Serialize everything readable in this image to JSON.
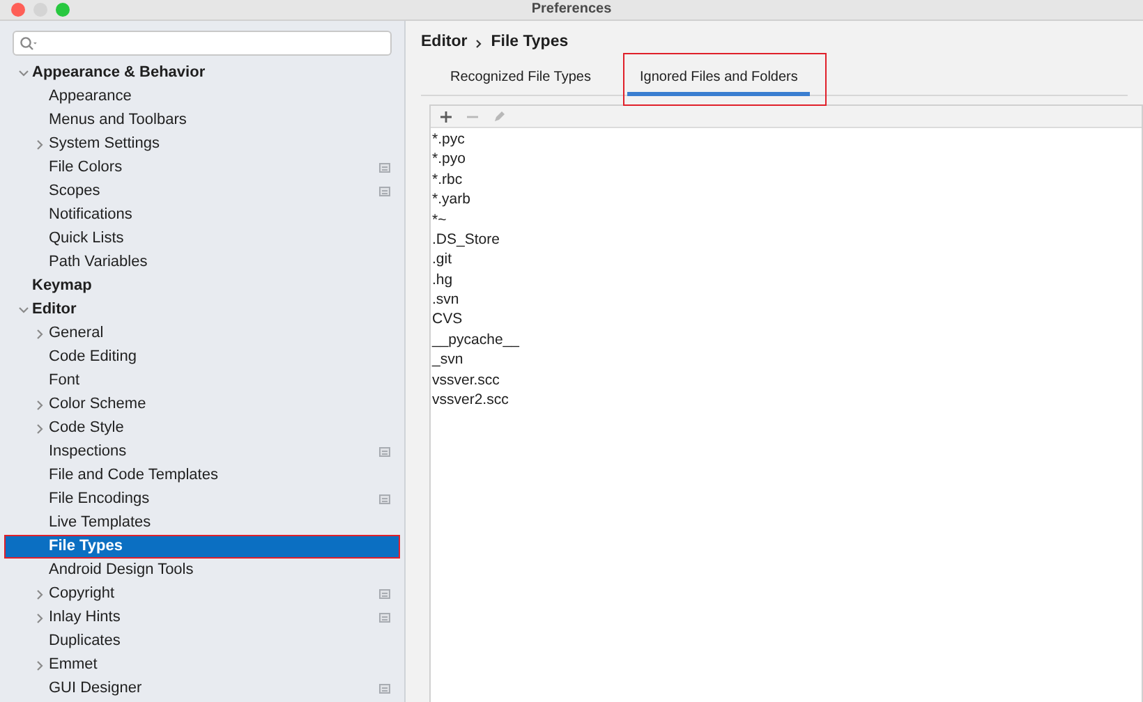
{
  "window": {
    "title": "Preferences",
    "buttons": [
      {
        "kind": "close",
        "disabled": false
      },
      {
        "kind": "minimize",
        "disabled": true
      },
      {
        "kind": "zoom",
        "disabled": false
      }
    ]
  },
  "sidebar": {
    "items": [
      {
        "label": "Appearance & Behavior",
        "expanded": true,
        "selected": false,
        "annotated": false,
        "scope_icon": false,
        "children": [
          {
            "label": "Appearance",
            "selected": false,
            "annotated": false,
            "scope_icon": false
          },
          {
            "label": "Menus and Toolbars",
            "selected": false,
            "annotated": false,
            "scope_icon": false
          },
          {
            "label": "System Settings",
            "expanded": false,
            "selected": false,
            "annotated": false,
            "scope_icon": false
          },
          {
            "label": "File Colors",
            "selected": false,
            "annotated": false,
            "scope_icon": true
          },
          {
            "label": "Scopes",
            "selected": false,
            "annotated": false,
            "scope_icon": true
          },
          {
            "label": "Notifications",
            "selected": false,
            "annotated": false,
            "scope_icon": false
          },
          {
            "label": "Quick Lists",
            "selected": false,
            "annotated": false,
            "scope_icon": false
          },
          {
            "label": "Path Variables",
            "selected": false,
            "annotated": false,
            "scope_icon": false
          }
        ]
      },
      {
        "label": "Keymap",
        "selected": false,
        "annotated": false,
        "scope_icon": false
      },
      {
        "label": "Editor",
        "expanded": true,
        "selected": false,
        "annotated": false,
        "scope_icon": false,
        "children": [
          {
            "label": "General",
            "expanded": false,
            "selected": false,
            "annotated": false,
            "scope_icon": false
          },
          {
            "label": "Code Editing",
            "selected": false,
            "annotated": false,
            "scope_icon": false
          },
          {
            "label": "Font",
            "selected": false,
            "annotated": false,
            "scope_icon": false
          },
          {
            "label": "Color Scheme",
            "expanded": false,
            "selected": false,
            "annotated": false,
            "scope_icon": false
          },
          {
            "label": "Code Style",
            "expanded": false,
            "selected": false,
            "annotated": false,
            "scope_icon": false
          },
          {
            "label": "Inspections",
            "selected": false,
            "annotated": false,
            "scope_icon": true
          },
          {
            "label": "File and Code Templates",
            "selected": false,
            "annotated": false,
            "scope_icon": false
          },
          {
            "label": "File Encodings",
            "selected": false,
            "annotated": false,
            "scope_icon": true
          },
          {
            "label": "Live Templates",
            "selected": false,
            "annotated": false,
            "scope_icon": false
          },
          {
            "label": "File Types",
            "selected": true,
            "annotated": true,
            "scope_icon": false
          },
          {
            "label": "Android Design Tools",
            "selected": false,
            "annotated": false,
            "scope_icon": false
          },
          {
            "label": "Copyright",
            "expanded": false,
            "selected": false,
            "annotated": false,
            "scope_icon": true
          },
          {
            "label": "Inlay Hints",
            "expanded": false,
            "selected": false,
            "annotated": false,
            "scope_icon": true
          },
          {
            "label": "Duplicates",
            "selected": false,
            "annotated": false,
            "scope_icon": false
          },
          {
            "label": "Emmet",
            "expanded": false,
            "selected": false,
            "annotated": false,
            "scope_icon": false
          },
          {
            "label": "GUI Designer",
            "selected": false,
            "annotated": false,
            "scope_icon": true
          }
        ]
      }
    ]
  },
  "breadcrumb": [
    "Editor",
    "File Types"
  ],
  "tabs": [
    {
      "label": "Recognized File Types",
      "selected": false,
      "annotated": false
    },
    {
      "label": "Ignored Files and Folders",
      "selected": true,
      "annotated": true
    }
  ],
  "toolbar": [
    {
      "kind": "add",
      "disabled": false
    },
    {
      "kind": "remove",
      "disabled": true
    },
    {
      "kind": "edit",
      "disabled": true
    }
  ],
  "patterns": [
    "*.pyc",
    "*.pyo",
    "*.rbc",
    "*.yarb",
    "*~",
    ".DS_Store",
    ".git",
    ".hg",
    ".svn",
    "CVS",
    "__pycache__",
    "_svn",
    "vssver.scc",
    "vssver2.scc"
  ]
}
